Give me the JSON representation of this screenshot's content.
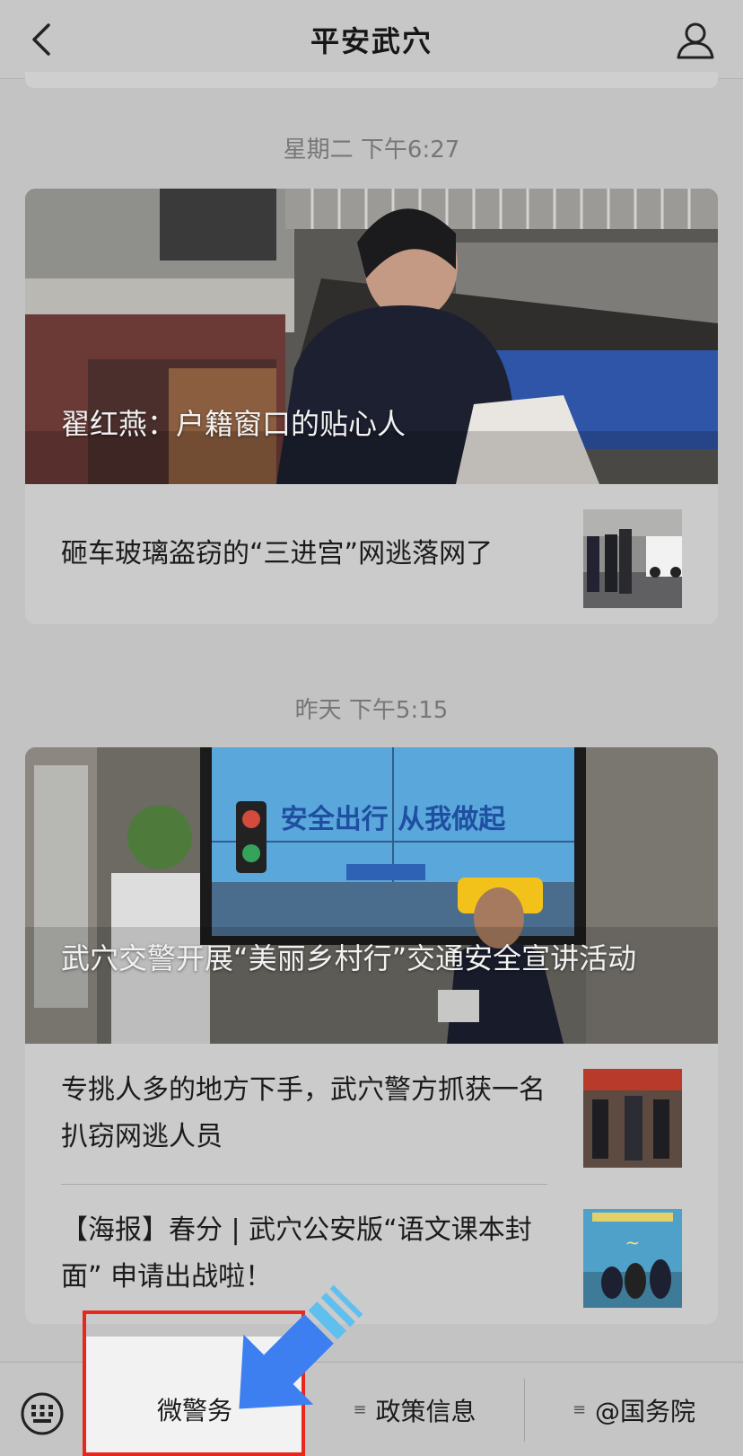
{
  "header": {
    "title": "平安武穴",
    "back_icon": "chevron-left-icon",
    "profile_icon": "user-icon"
  },
  "groups": [
    {
      "timestamp": "星期二 下午6:27",
      "cover_title": "翟红燕：户籍窗口的贴心人",
      "items": [
        {
          "title": "砸车玻璃盗窃的“三进宫”网逃落网了"
        }
      ]
    },
    {
      "timestamp": "昨天 下午5:15",
      "cover_title": "武穴交警开展“美丽乡村行”交通安全宣讲活动",
      "cover_screen_text": "安全出行 从我做起",
      "items": [
        {
          "title": "专挑人多的地方下手，武穴警方抓获一名扒窃网逃人员"
        },
        {
          "title": "【海报】春分 | 武穴公安版“语文课本封面” 申请出战啦！"
        }
      ]
    }
  ],
  "bottom_menu": {
    "keyboard_icon": "keyboard-icon",
    "tabs": [
      {
        "label": "微警务"
      },
      {
        "label": "政策信息"
      },
      {
        "label": "@国务院"
      }
    ]
  },
  "colors": {
    "highlight_border": "#e8271d",
    "arrow": "#3d7ff0"
  }
}
